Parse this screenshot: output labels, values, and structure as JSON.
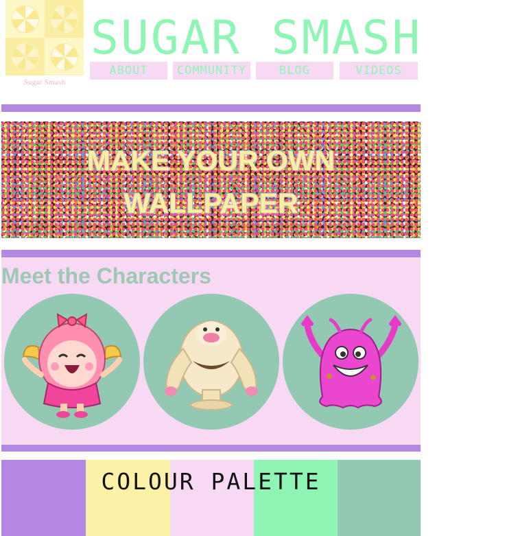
{
  "header": {
    "logo_text": "Sugar Smash",
    "title": "SUGAR SMASH",
    "nav": [
      {
        "label": "ABOUT"
      },
      {
        "label": "COMMUNITY"
      },
      {
        "label": "BLOG"
      },
      {
        "label": "VIDEOS"
      }
    ]
  },
  "hero": {
    "line1": "MAKE YOUR OWN",
    "line2": "WALLPAPER"
  },
  "characters": {
    "title": "Meet the Characters",
    "items": [
      {
        "icon": "girl-character-icon"
      },
      {
        "icon": "yeti-character-icon"
      },
      {
        "icon": "pink-blob-character-icon"
      }
    ]
  },
  "palette": {
    "title": "COLOUR PALETTE",
    "colors": [
      "#b487e3",
      "#fdf1a8",
      "#f8d9f4",
      "#8ef5b5",
      "#93c9b3"
    ]
  }
}
